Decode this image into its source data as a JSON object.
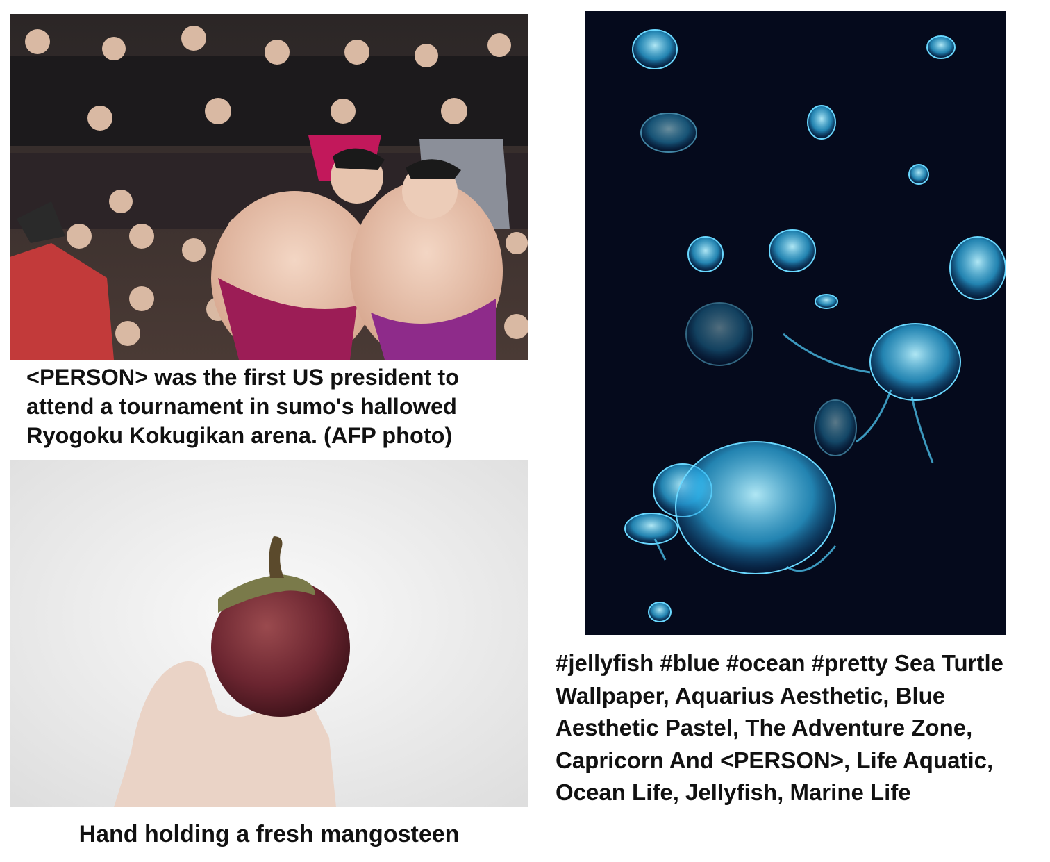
{
  "panels": {
    "sumo": {
      "caption": "<PERSON> was the first US president to attend a tournament in sumo's hallowed Ryogoku Kokugikan arena. (AFP photo)"
    },
    "mango": {
      "caption": "Hand holding a fresh mangosteen"
    },
    "jellyfish": {
      "caption": "#jellyfish #blue #ocean #pretty Sea Turtle Wallpaper, Aquarius Aesthetic, Blue Aesthetic Pastel, The Adventure Zone, Capricorn And <PERSON>, Life Aquatic, Ocean Life, Jellyfish, Marine Life"
    }
  }
}
